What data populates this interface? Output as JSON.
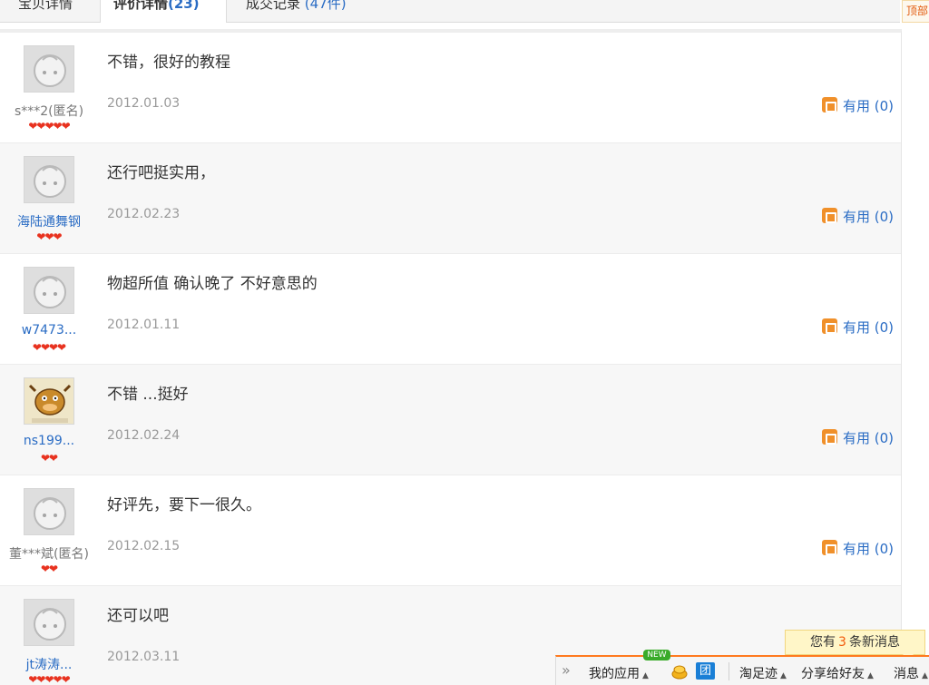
{
  "tabs": {
    "t1": "宝贝详情",
    "t2_label": "评价详情",
    "t2_count": "(23)",
    "t3_label": "成交记录",
    "t3_count": "(47件)"
  },
  "topright": "顶部",
  "reviews": [
    {
      "user": "s***2(匿名)",
      "hearts": "❤❤❤❤❤",
      "text": "不错，很好的教程",
      "date": "2012.01.03",
      "useful": "有用 (0)"
    },
    {
      "user": "海陆通舞钢",
      "hearts": "❤❤❤",
      "text": "还行吧挺实用，",
      "date": "2012.02.23",
      "useful": "有用 (0)"
    },
    {
      "user": "w7473...",
      "hearts": "❤❤❤❤",
      "text": "物超所值 确认晚了 不好意思的",
      "date": "2012.01.11",
      "useful": "有用 (0)"
    },
    {
      "user": "ns199...",
      "hearts": "❤❤",
      "text": "不错 ...挺好",
      "date": "2012.02.24",
      "useful": "有用 (0)"
    },
    {
      "user": "董***斌(匿名)",
      "hearts": "❤❤",
      "text": "好评先，要下一很久。",
      "date": "2012.02.15",
      "useful": "有用 (0)"
    },
    {
      "user": "jt涛涛...",
      "hearts": "❤❤❤❤❤",
      "text": "还可以吧",
      "date": "2012.03.11",
      "useful": ""
    }
  ],
  "toolbar": {
    "msg_prefix": "您有",
    "msg_count": "3",
    "msg_suffix": "条新消息",
    "arrows": "»",
    "my_apps": "我的应用",
    "new_badge": "NEW",
    "tuan": "团",
    "footprints": "淘足迹",
    "share": "分享给好友",
    "messages": "消息"
  },
  "colors": {
    "link": "#2a6cc4",
    "heart": "#e8321f",
    "accent": "#ff7a1f"
  }
}
